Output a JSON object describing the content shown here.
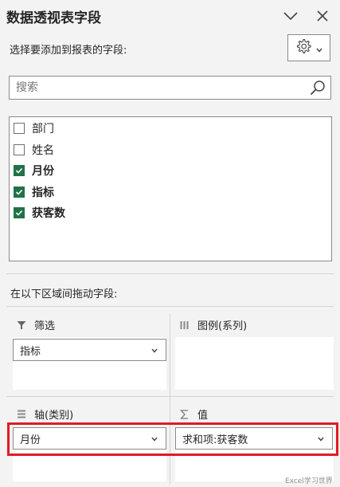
{
  "panel": {
    "title": "数据透视表字段",
    "subtitle": "选择要添加到报表的字段:"
  },
  "search": {
    "placeholder": "搜索"
  },
  "fields": [
    {
      "label": "部门",
      "checked": false
    },
    {
      "label": "姓名",
      "checked": false
    },
    {
      "label": "月份",
      "checked": true
    },
    {
      "label": "指标",
      "checked": true
    },
    {
      "label": "获客数",
      "checked": true
    }
  ],
  "areas": {
    "prompt": "在以下区域间拖动字段:",
    "filters": {
      "label": "筛选",
      "icon": "filter-icon",
      "items": [
        "指标"
      ]
    },
    "columns": {
      "label": "图例(系列)",
      "icon": "columns-icon",
      "items": []
    },
    "rows": {
      "label": "轴(类别)",
      "icon": "rows-icon",
      "items": [
        "月份"
      ]
    },
    "values": {
      "label": "值",
      "icon": "sigma-icon",
      "items": [
        "求和项:获客数"
      ]
    }
  },
  "watermark": "Excel学习世界",
  "colors": {
    "checkbox_checked": "#217346",
    "highlight": "#e01b24"
  }
}
